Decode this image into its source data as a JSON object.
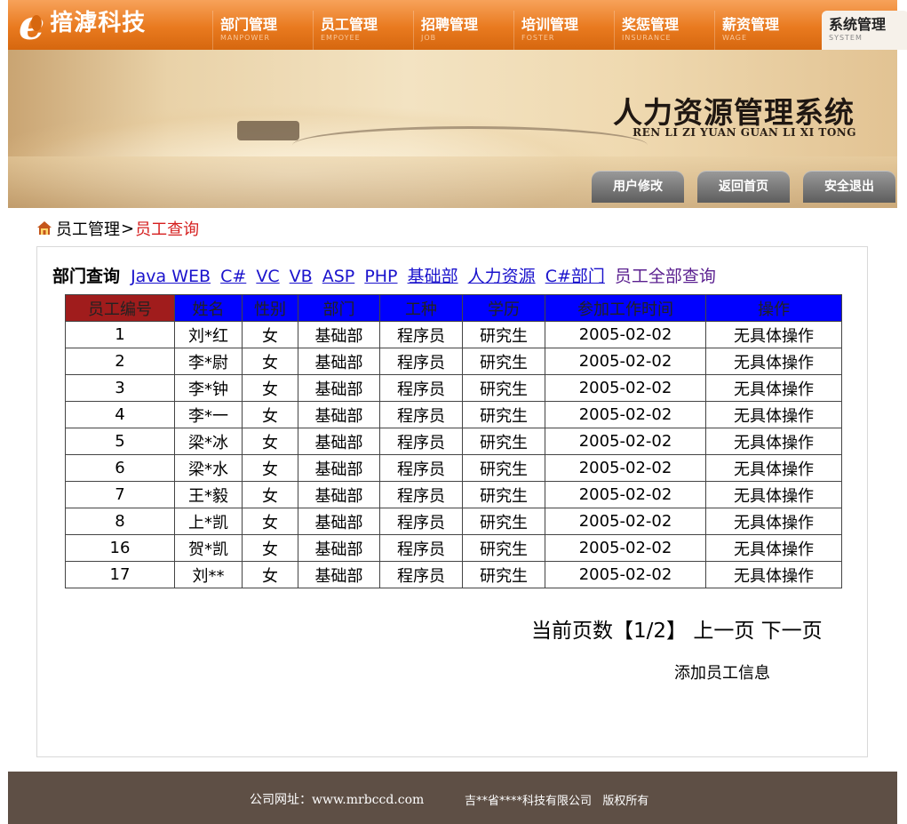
{
  "brand": {
    "logo_letter": "e",
    "name": "揞滹科技"
  },
  "nav": [
    {
      "zh": "部门管理",
      "en": "MANPOWER"
    },
    {
      "zh": "员工管理",
      "en": "EMPOYEE"
    },
    {
      "zh": "招聘管理",
      "en": "JOB"
    },
    {
      "zh": "培训管理",
      "en": "FOSTER"
    },
    {
      "zh": "奖惩管理",
      "en": "INSURANCE"
    },
    {
      "zh": "薪资管理",
      "en": "WAGE"
    },
    {
      "zh": "系统管理",
      "en": "SYSTEM"
    }
  ],
  "banner": {
    "title": "人力资源管理系统",
    "subtitle": "REN LI ZI YUAN GUAN LI XI TONG",
    "buttons": [
      "用户修改",
      "返回首页",
      "安全退出"
    ]
  },
  "breadcrumb": {
    "parent": "员工管理",
    "separator": ">",
    "current": "员工查询"
  },
  "filter": {
    "label": "部门查询",
    "links": [
      "Java WEB",
      "C#",
      "VC",
      "VB",
      "ASP",
      "PHP",
      "基础部",
      "人力资源",
      "C#部门"
    ],
    "all_link": "员工全部查询"
  },
  "table": {
    "headers": [
      "员工编号",
      "姓名",
      "性别",
      "部门",
      "工种",
      "学历",
      "参加工作时间",
      "操作"
    ],
    "rows": [
      [
        "1",
        "刘*红",
        "女",
        "基础部",
        "程序员",
        "研究生",
        "2005-02-02",
        "无具体操作"
      ],
      [
        "2",
        "李*尉",
        "女",
        "基础部",
        "程序员",
        "研究生",
        "2005-02-02",
        "无具体操作"
      ],
      [
        "3",
        "李*钟",
        "女",
        "基础部",
        "程序员",
        "研究生",
        "2005-02-02",
        "无具体操作"
      ],
      [
        "4",
        "李*一",
        "女",
        "基础部",
        "程序员",
        "研究生",
        "2005-02-02",
        "无具体操作"
      ],
      [
        "5",
        "梁*冰",
        "女",
        "基础部",
        "程序员",
        "研究生",
        "2005-02-02",
        "无具体操作"
      ],
      [
        "6",
        "梁*水",
        "女",
        "基础部",
        "程序员",
        "研究生",
        "2005-02-02",
        "无具体操作"
      ],
      [
        "7",
        "王*毅",
        "女",
        "基础部",
        "程序员",
        "研究生",
        "2005-02-02",
        "无具体操作"
      ],
      [
        "8",
        "上*凯",
        "女",
        "基础部",
        "程序员",
        "研究生",
        "2005-02-02",
        "无具体操作"
      ],
      [
        "16",
        "贺*凯",
        "女",
        "基础部",
        "程序员",
        "研究生",
        "2005-02-02",
        "无具体操作"
      ],
      [
        "17",
        "刘**",
        "女",
        "基础部",
        "程序员",
        "研究生",
        "2005-02-02",
        "无具体操作"
      ]
    ]
  },
  "pager": {
    "status": "当前页数【1/2】",
    "prev": "上一页",
    "next": "下一页"
  },
  "add_link": "添加员工信息",
  "footer": {
    "site": "公司网址：www.mrbccd.com",
    "copyright": "吉**省****科技有限公司   版权所有"
  }
}
